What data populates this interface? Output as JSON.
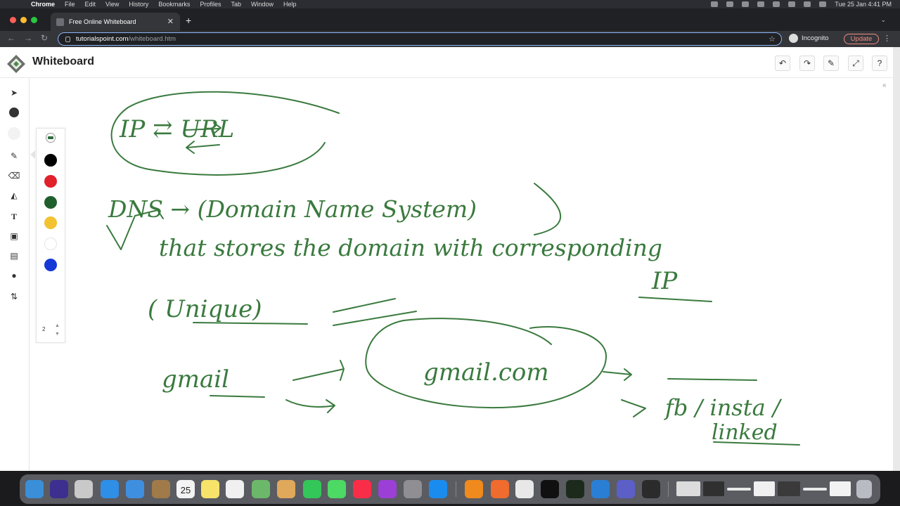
{
  "menubar": {
    "app_name": "Chrome",
    "items": [
      "File",
      "Edit",
      "View",
      "History",
      "Bookmarks",
      "Profiles",
      "Tab",
      "Window",
      "Help"
    ],
    "clock": "Tue 25 Jan  4:41 PM"
  },
  "browser": {
    "tab_title": "Free Online Whiteboard",
    "url_host": "tutorialspoint.com",
    "url_path": "/whiteboard.htm",
    "profile_label": "Incognito",
    "update_label": "Update"
  },
  "app": {
    "title": "Whiteboard",
    "stroke_width": "2",
    "colors": [
      "#000000",
      "#e0202a",
      "#1f5f2d",
      "#f2c230",
      "#ffffff",
      "#1638d6"
    ],
    "ink_color": "#3a7a3e"
  },
  "whiteboard_text": {
    "note_1": "IP ⇄ URL",
    "note_2": "DNS → (Domain Name System)",
    "note_3": "that stores the domain with corresponding",
    "note_4": "IP",
    "note_5": "( Unique)",
    "note_6": "gmail",
    "note_7": "gmail.com",
    "note_8": "fb / insta /",
    "note_9": "linked"
  },
  "dock": {
    "calendar_day": "25"
  }
}
